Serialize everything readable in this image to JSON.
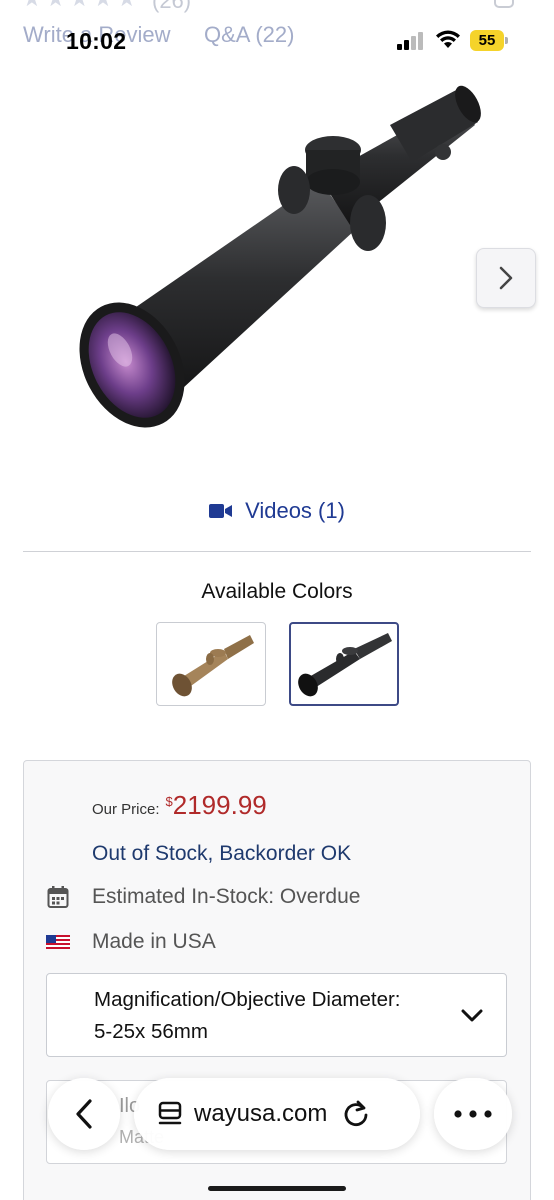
{
  "header_faded": {
    "stars": "★★★★★",
    "review_count": "(26)",
    "write_review": "Write a Review",
    "qa": "Q&A (22)"
  },
  "status_bar": {
    "time": "10:02",
    "battery": "55"
  },
  "product": {
    "image_icon": "rifle-scope-image"
  },
  "videos": {
    "label": "Videos (1)",
    "icon": "video-camera-icon"
  },
  "colors": {
    "title": "Available Colors",
    "options": [
      {
        "name": "tan-scope-swatch",
        "color": "#9c7b52"
      },
      {
        "name": "black-scope-swatch",
        "color": "#2a2b2d",
        "selected": true
      }
    ]
  },
  "buy_box": {
    "price_label": "Our Price:",
    "currency": "$",
    "price": "2199.99",
    "stock_status": "Out of Stock, Backorder OK",
    "estimated": "Estimated In-Stock: Overdue",
    "made_in": "Made in USA",
    "option_label": "Magnification/Objective Diameter:",
    "option_value": "5-25x 56mm",
    "second_option_label": "Ilo",
    "second_option_value": "Matte"
  },
  "browser": {
    "url": "wayusa.com"
  },
  "colors_theme": {
    "accent_blue": "#1f3a93",
    "price_red": "#b02a2a",
    "stock_blue": "#1f3a6e"
  }
}
